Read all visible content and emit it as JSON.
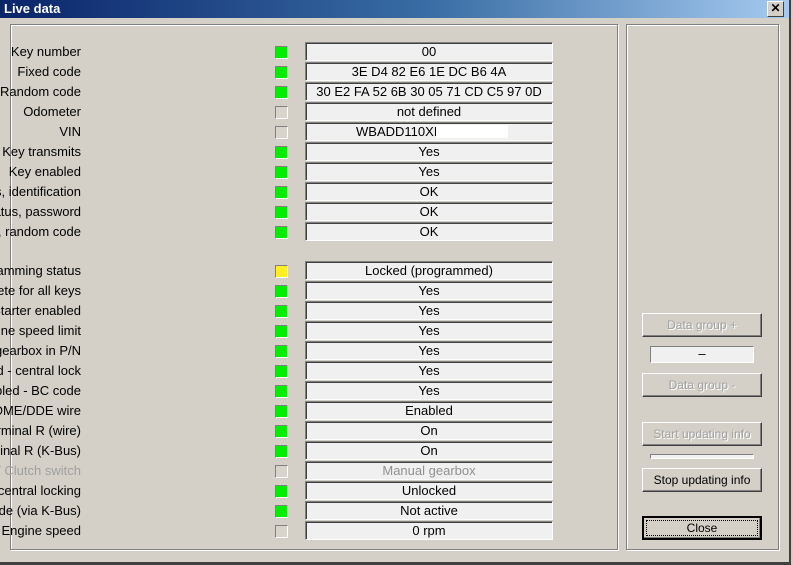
{
  "window": {
    "title": "Live data",
    "close_glyph": "✕"
  },
  "rows": [
    {
      "label": "Key number",
      "status": "green",
      "value": "00"
    },
    {
      "label": "Fixed code",
      "status": "green",
      "value": "3E D4 82 E6 1E DC B6 4A"
    },
    {
      "label": "Random code",
      "status": "green",
      "value": "30 E2 FA 52 6B 30 05 71 CD C5 97 0D"
    },
    {
      "label": "Odometer",
      "status": "off",
      "value": "not defined"
    },
    {
      "label": "VIN",
      "status": "off",
      "value": "WBADD110XI"
    },
    {
      "label": "Key transmits",
      "status": "green",
      "value": "Yes"
    },
    {
      "label": "Key enabled",
      "status": "green",
      "value": "Yes"
    },
    {
      "label": "Status, identification",
      "status": "green",
      "value": "OK"
    },
    {
      "label": "Status, password",
      "status": "green",
      "value": "OK"
    },
    {
      "label": "Status, random code",
      "status": "green",
      "value": "OK"
    },
    {
      "label": "EWS programming status",
      "status": "yellow",
      "value": "Locked (programmed)"
    },
    {
      "label": "Auto-init complete for all keys",
      "status": "green",
      "value": "Yes"
    },
    {
      "label": "Starter enabled",
      "status": "green",
      "value": "Yes"
    },
    {
      "label": "Starter enabled - engine speed limit",
      "status": "green",
      "value": "Yes"
    },
    {
      "label": "Starter enabled - gearbox in P/N",
      "status": "green",
      "value": "Yes"
    },
    {
      "label": "Starter enabled - central lock",
      "status": "green",
      "value": "Yes"
    },
    {
      "label": "Starter enabled - BC code",
      "status": "green",
      "value": "Yes"
    },
    {
      "label": "Status, DME/DDE wire",
      "status": "green",
      "value": "Enabled"
    },
    {
      "label": "Terminal R (wire)",
      "status": "green",
      "value": "On"
    },
    {
      "label": "Terminal R (K-Bus)",
      "status": "green",
      "value": "On"
    },
    {
      "label": "Selector lever / Clutch switch",
      "status": "off",
      "value": "Manual gearbox",
      "disabled": true
    },
    {
      "label": "Status, central locking",
      "status": "green",
      "value": "Unlocked"
    },
    {
      "label": "BC code (via K-Bus)",
      "status": "green",
      "value": "Not active"
    },
    {
      "label": "Engine speed",
      "status": "off",
      "value": "0 rpm"
    }
  ],
  "colors": {
    "green": "#00ee00",
    "yellow": "#ffee22",
    "off": "#d8d4cc"
  },
  "side": {
    "data_group_plus": "Data group +",
    "data_group_value": "–",
    "data_group_minus": "Data group -",
    "start_updating": "Start updating info",
    "update_progress": 0,
    "stop_updating": "Stop updating info",
    "close": "Close"
  }
}
